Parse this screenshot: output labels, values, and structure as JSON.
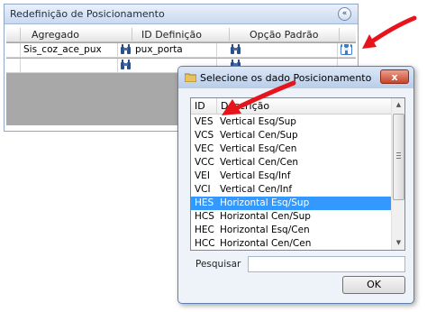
{
  "panel": {
    "title": "Redefinição de Posicionamento",
    "collapse_glyph": "«",
    "columns": [
      "Agregado",
      "ID Definição",
      "Opção Padrão"
    ],
    "rows": [
      {
        "agregado": "Sis_coz_ace_pux",
        "definicao": "pux_porta",
        "opcao": ""
      },
      {
        "agregado": "",
        "definicao": "",
        "opcao": ""
      }
    ]
  },
  "dialog": {
    "title": "Selecione os dado  Posicionamento",
    "close_glyph": "x",
    "columns": {
      "id": "ID",
      "desc": "Descrição"
    },
    "items": [
      {
        "id": "VES",
        "desc": "Vertical Esq/Sup"
      },
      {
        "id": "VCS",
        "desc": "Vertical Cen/Sup"
      },
      {
        "id": "VEC",
        "desc": "Vertical Esq/Cen"
      },
      {
        "id": "VCC",
        "desc": "Vertical Cen/Cen"
      },
      {
        "id": "VEI",
        "desc": "Vertical Esq/Inf"
      },
      {
        "id": "VCI",
        "desc": "Vertical Cen/Inf"
      },
      {
        "id": "HES",
        "desc": "Horizontal Esq/Sup"
      },
      {
        "id": "HCS",
        "desc": "Horizontal Cen/Sup"
      },
      {
        "id": "HEC",
        "desc": "Horizontal Esq/Cen"
      },
      {
        "id": "HCC",
        "desc": "Horizontal Cen/Cen"
      }
    ],
    "selected_id": "HES",
    "search_label": "Pesquisar",
    "search_value": "",
    "ok_label": "OK"
  },
  "colors": {
    "selection": "#3399ff",
    "arrow": "#e8141c",
    "close": "#c8442a"
  },
  "icons": {
    "lookup": "binoculars-icon",
    "folder": "folder-icon",
    "close": "close-icon"
  }
}
